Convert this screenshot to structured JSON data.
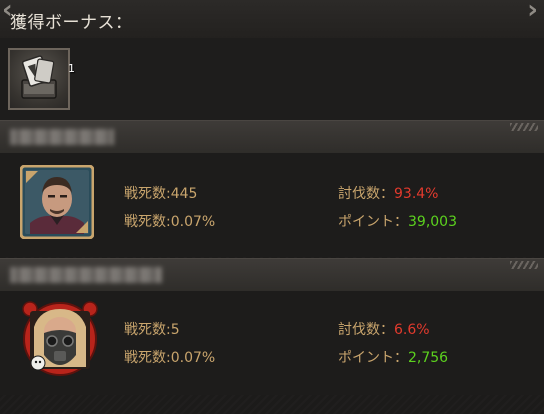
{
  "header": {
    "title": "獲得ボーナス："
  },
  "reward": {
    "icon": "card-deck-icon",
    "count": "1"
  },
  "players": [
    {
      "avatar": "male-soldier-portrait",
      "frame_color": "#c9a56d",
      "killed_label": "戦死数",
      "killed_value": "445",
      "killed_rate_label": "戦死数",
      "killed_rate_value": "0.07%",
      "defeat_label": "討伐数：",
      "defeat_value": "93.4%",
      "points_label": "ポイント：",
      "points_value": "39,003"
    },
    {
      "avatar": "gas-mask-portrait",
      "frame_color": "#b8241b",
      "killed_label": "戦死数",
      "killed_value": "5",
      "killed_rate_label": "戦死数",
      "killed_rate_value": "0.07%",
      "defeat_label": "討伐数：",
      "defeat_value": "6.6%",
      "points_label": "ポイント：",
      "points_value": "2,756"
    }
  ],
  "colors": {
    "gold": "#c9a56d",
    "red": "#e23a2d",
    "green": "#5cd21e"
  }
}
